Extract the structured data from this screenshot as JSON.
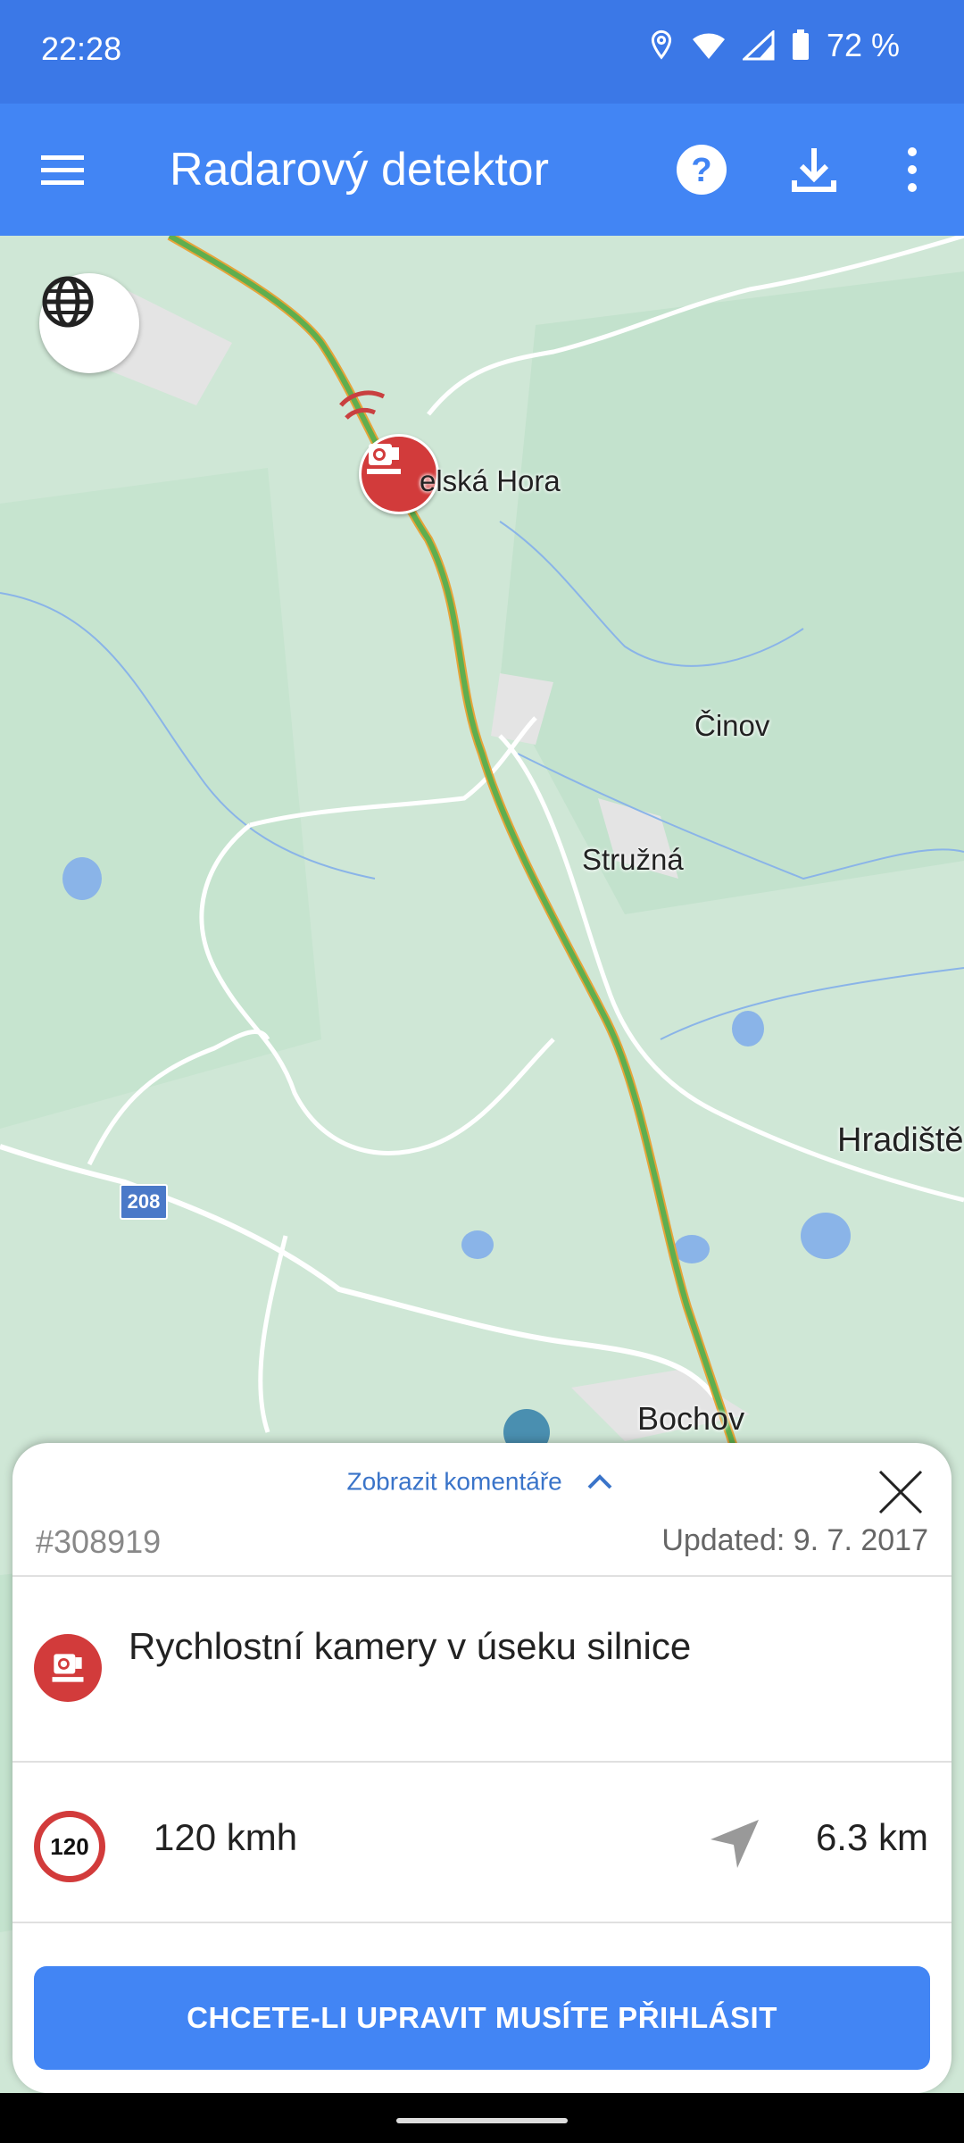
{
  "status_bar": {
    "time": "22:28",
    "battery": "72 %"
  },
  "app_bar": {
    "title": "Radarový detektor"
  },
  "map": {
    "labels": {
      "place1": "elská Hora",
      "place2": "Činov",
      "place3": "Stružná",
      "place4": "Hradiště",
      "place5": "Bochov"
    },
    "route_number": "208"
  },
  "sheet": {
    "show_comments": "Zobrazit komentáře",
    "id": "#308919",
    "updated": "Updated: 9. 7. 2017",
    "type": "Rychlostní kamery v úseku silnice",
    "speed_sign": "120",
    "speed_limit": "120 kmh",
    "distance": "6.3 km",
    "login_button": "CHCETE-LI UPRAVIT MUSÍTE PŘIHLÁSIT"
  },
  "colors": {
    "primary": "#4285f4",
    "status_bar": "#3b78e7",
    "marker_red": "#d23b3b",
    "link_blue": "#3a74c9"
  }
}
